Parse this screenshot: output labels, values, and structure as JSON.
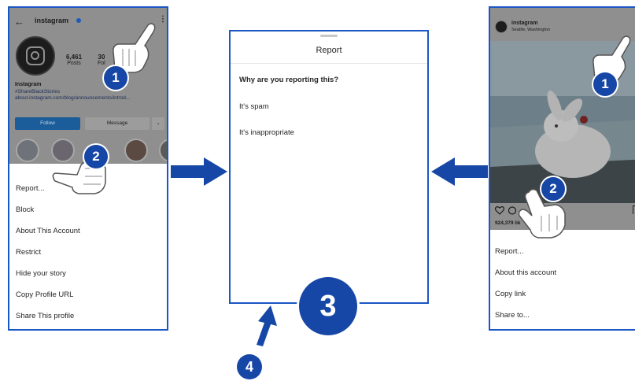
{
  "left_panel": {
    "header_title": "instagram",
    "stats": [
      {
        "value": "6,461",
        "label": "Posts"
      },
      {
        "value": "30",
        "label": "Fol"
      }
    ],
    "bio_name": "Instagram",
    "bio_tag": "#ShareBlackStories",
    "bio_link": "about.instagram.com/blog/announcements/introd...",
    "follow_label": "Follow",
    "message_label": "Message",
    "menu": [
      "Report...",
      "Block",
      "About This Account",
      "Restrict",
      "Hide your story",
      "Copy Profile URL",
      "Share This profile"
    ]
  },
  "middle_panel": {
    "title": "Report",
    "question": "Why are you reporting this?",
    "options": [
      "It's spam",
      "It's inappropriate"
    ]
  },
  "right_panel": {
    "account_name": "instagram",
    "location": "Seattle, Washington",
    "likes_text": "924,379 lik",
    "menu": [
      "Report...",
      "About this account",
      "Copy link",
      "Share to..."
    ]
  },
  "steps": {
    "one": "1",
    "two": "2",
    "three": "3",
    "four": "4"
  },
  "colors": {
    "accent_blue": "#1a56c4",
    "badge_blue": "#1747a6",
    "follow_blue": "#0095f6"
  }
}
